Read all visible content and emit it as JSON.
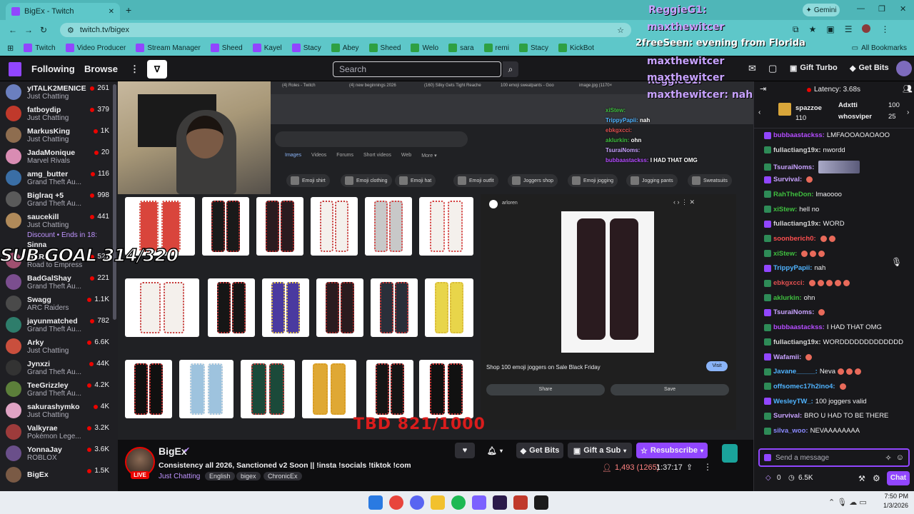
{
  "browser": {
    "tab_title": "BigEx - Twitch",
    "url": "twitch.tv/bigex",
    "gemini_label": "Gemini",
    "bookmarks": [
      "Twitch",
      "Video Producer",
      "Stream Manager",
      "Sheed",
      "Kayel",
      "Stacy",
      "Abey",
      "Sheed",
      "Welo",
      "sara",
      "remi",
      "Stacy",
      "KickBot"
    ],
    "all_bookmarks": "All Bookmarks"
  },
  "nav": {
    "following": "Following",
    "browse": "Browse",
    "search_placeholder": "Search",
    "gift_turbo": "Gift Turbo",
    "get_bits": "Get Bits"
  },
  "sidebar": {
    "channels": [
      {
        "name": "yITALK2MENICE",
        "game": "Just Chatting",
        "viewers": "261",
        "color": "#6b7fbf"
      },
      {
        "name": "fatboydip",
        "game": "Just Chatting",
        "viewers": "379",
        "color": "#c0392b"
      },
      {
        "name": "MarkusKing",
        "game": "Just Chatting",
        "viewers": "1K",
        "color": "#8e6d4f"
      },
      {
        "name": "JadaMonique",
        "game": "Marvel Rivals",
        "viewers": "20",
        "color": "#d98cb3"
      },
      {
        "name": "amg_butter",
        "game": "Grand Theft Au...",
        "viewers": "116",
        "color": "#3a6ea5"
      },
      {
        "name": "Biglraq +5",
        "game": "Grand Theft Au...",
        "viewers": "998",
        "color": "#5a5a5a"
      },
      {
        "name": "saucekill",
        "game": "Just Chatting",
        "viewers": "441",
        "color": "#b08a5a"
      },
      {
        "name": "MARI",
        "game": "Road to Empress",
        "viewers": "521",
        "color": "#a05070"
      },
      {
        "name": "BadGalShay",
        "game": "Grand Theft Au...",
        "viewers": "221",
        "color": "#7b4e8f"
      },
      {
        "name": "Swagg",
        "game": "ARC Raiders",
        "viewers": "1.1K",
        "color": "#4a4a4a"
      },
      {
        "name": "jayunmatched",
        "game": "Grand Theft Au...",
        "viewers": "782",
        "color": "#2e7d6b"
      },
      {
        "name": "Arky",
        "game": "Just Chatting",
        "viewers": "6.6K",
        "color": "#c94f3d"
      },
      {
        "name": "Jynxzi",
        "game": "Grand Theft Au...",
        "viewers": "44K",
        "color": "#333"
      },
      {
        "name": "TeeGrizzley",
        "game": "Grand Theft Au...",
        "viewers": "4.2K",
        "color": "#5c7f3a"
      },
      {
        "name": "sakurashymko",
        "game": "Just Chatting",
        "viewers": "4K",
        "color": "#e0a3c4"
      },
      {
        "name": "Valkyrae",
        "game": "Pokémon Lege...",
        "viewers": "3.2K",
        "color": "#9d3b3b"
      },
      {
        "name": "YonnaJay",
        "game": "ROBLOX",
        "viewers": "3.6K",
        "color": "#6a4f8a"
      },
      {
        "name": "BigEx",
        "game": "",
        "viewers": "1.5K",
        "color": "#7a5a45"
      }
    ],
    "discount": "Discount • Ends in 18:",
    "partial": "Sinna"
  },
  "stream_overlay": {
    "sub_goal": "SUB GOAL 314/320",
    "tbd_goal": "TBD 821/1000",
    "reggie": "ReggieG1:",
    "maxthewitcer": "maxthewitcer",
    "free_seen": "2freeSeen: evening from Florida",
    "max_nahhh": "maxthewitcer: nahhh",
    "preview_caption": "Shop 100 emoji joggers on Sale Black Friday",
    "preview_source": "arloren",
    "preview_visit": "Visit",
    "preview_share": "Share",
    "preview_save": "Save",
    "chips": [
      "Emoji shirt",
      "Emoji clothing",
      "Emoji hat",
      "Emoji outfit",
      "Joggers shop",
      "Emoji jogging",
      "Jogging pants",
      "Sweatsuits"
    ],
    "mini_chat": [
      {
        "u": "xiStew:",
        "t": "",
        "c": "#3fbf3f"
      },
      {
        "u": "TrippyPapii:",
        "t": "nah",
        "c": "#4fb3ff"
      },
      {
        "u": "ebkgxcci:",
        "t": "",
        "c": "#e05050"
      },
      {
        "u": "aklurkin:",
        "t": "ohn",
        "c": "#3fbf3f"
      },
      {
        "u": "TsuraiNoms:",
        "t": "",
        "c": "#c8a2ff"
      },
      {
        "u": "bubbaastackss:",
        "t": "I HAD THAT OMG",
        "c": "#b44cff"
      }
    ]
  },
  "channel": {
    "name": "BigEx",
    "title": "Consistency all 2026, Sanctioned v2 Soon || !insta !socials !tiktok !com",
    "category": "Just Chatting",
    "tags": [
      "English",
      "bigex",
      "ChronicEx"
    ],
    "live": "LIVE",
    "viewers": "1,493 (1265)",
    "uptime": "1:37:17",
    "get_bits": "Get Bits",
    "gift_sub": "Gift a Sub",
    "resubscribe": "Resubscribe"
  },
  "chat": {
    "latency": "Latency: 3.68s",
    "leaders": [
      {
        "name": "spazzoe",
        "count": "110"
      },
      {
        "name": "Adxtti",
        "count": "100"
      },
      {
        "name": "whosviper",
        "count": "25"
      }
    ],
    "messages": [
      {
        "u": "bubbaastackss:",
        "t": "LMFAOOAOAOAOO",
        "c": "#b44cff"
      },
      {
        "u": "fullactiang19x:",
        "t": "nwordd",
        "c": "#d4d4d4"
      },
      {
        "u": "TsuraiNoms:",
        "t": "",
        "c": "#c8a2ff",
        "pic": true
      },
      {
        "u": "Survival:",
        "t": "",
        "c": "#c8a2ff",
        "emo": 1
      },
      {
        "u": "RahTheDon:",
        "t": "lmaoooo",
        "c": "#3fbf3f"
      },
      {
        "u": "xiStew:",
        "t": "hell no",
        "c": "#3fbf3f"
      },
      {
        "u": "fullactiang19x:",
        "t": "WORD",
        "c": "#d4d4d4"
      },
      {
        "u": "soonberich0:",
        "t": "",
        "c": "#ff4f4f",
        "emo": 2
      },
      {
        "u": "xiStew:",
        "t": "",
        "c": "#3fbf3f",
        "emo": 3
      },
      {
        "u": "TrippyPapii:",
        "t": "nah",
        "c": "#4fb3ff"
      },
      {
        "u": "ebkgxcci:",
        "t": "",
        "c": "#e05050",
        "emo": 5
      },
      {
        "u": "aklurkin:",
        "t": "ohn",
        "c": "#3fbf3f"
      },
      {
        "u": "TsuraiNoms:",
        "t": "",
        "c": "#c8a2ff",
        "emo": 1
      },
      {
        "u": "bubbaastackss:",
        "t": "I HAD THAT OMG",
        "c": "#b44cff"
      },
      {
        "u": "fullactiang19x:",
        "t": "WORDDDDDDDDDDDDD",
        "c": "#d4d4d4"
      },
      {
        "u": "Wafamii:",
        "t": "",
        "c": "#c8a2ff",
        "emo": 1
      },
      {
        "u": "Javane_____:",
        "t": "Neva",
        "c": "#4fb3ff",
        "emo": 3
      },
      {
        "u": "offsomec17h2ino4:",
        "t": "",
        "c": "#4fb3ff",
        "emo": 1
      },
      {
        "u": "WesleyTW_:",
        "t": "100 joggers valid",
        "c": "#4fb3ff"
      },
      {
        "u": "Survival:",
        "t": "BRO U HAD TO BE THERE",
        "c": "#c8a2ff"
      },
      {
        "u": "silva_woo:",
        "t": "NEVAAAAAAAA",
        "c": "#8a8aff"
      }
    ],
    "input_placeholder": "Send a message",
    "points": "0",
    "bits": "6.5K",
    "chat_button": "Chat"
  },
  "taskbar": {
    "time": "7:50 PM",
    "date": "1/3/2026"
  },
  "colors": {
    "twitch_purple": "#9146ff",
    "live_red": "#eb0400",
    "chrome_teal": "#5ec7c9"
  }
}
